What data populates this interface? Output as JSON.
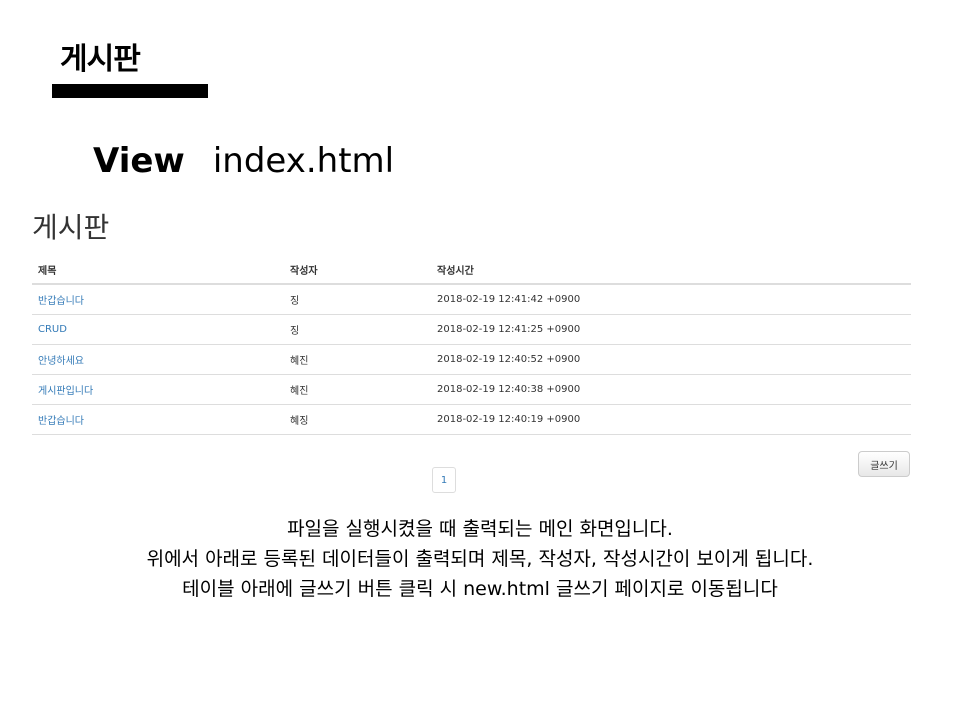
{
  "slide": {
    "title": "게시판",
    "subtitle_view": "View",
    "subtitle_file": "index.html"
  },
  "board": {
    "heading": "게시판",
    "columns": [
      "제목",
      "작성자",
      "작성시간"
    ],
    "rows": [
      {
        "title": "반갑습니다",
        "author": "징",
        "time": "2018-02-19 12:41:42 +0900"
      },
      {
        "title": "CRUD",
        "author": "징",
        "time": "2018-02-19 12:41:25 +0900"
      },
      {
        "title": "안녕하세요",
        "author": "혜진",
        "time": "2018-02-19 12:40:52 +0900"
      },
      {
        "title": "게시판입니다",
        "author": "혜진",
        "time": "2018-02-19 12:40:38 +0900"
      },
      {
        "title": "반갑습니다",
        "author": "혜징",
        "time": "2018-02-19 12:40:19 +0900"
      }
    ],
    "write_button": "글쓰기",
    "page_number": "1"
  },
  "description": {
    "line1": "파일을 실행시켰을 때 출력되는 메인 화면입니다.",
    "line2": "위에서 아래로 등록된 데이터들이 출력되며 제목, 작성자, 작성시간이 보이게 됩니다.",
    "line3": "테이블 아래에 글쓰기 버튼 클릭 시 new.html 글쓰기 페이지로 이동됩니다"
  },
  "colors": {
    "link": "#337ab7",
    "text": "#333333",
    "border": "#dddddd"
  }
}
